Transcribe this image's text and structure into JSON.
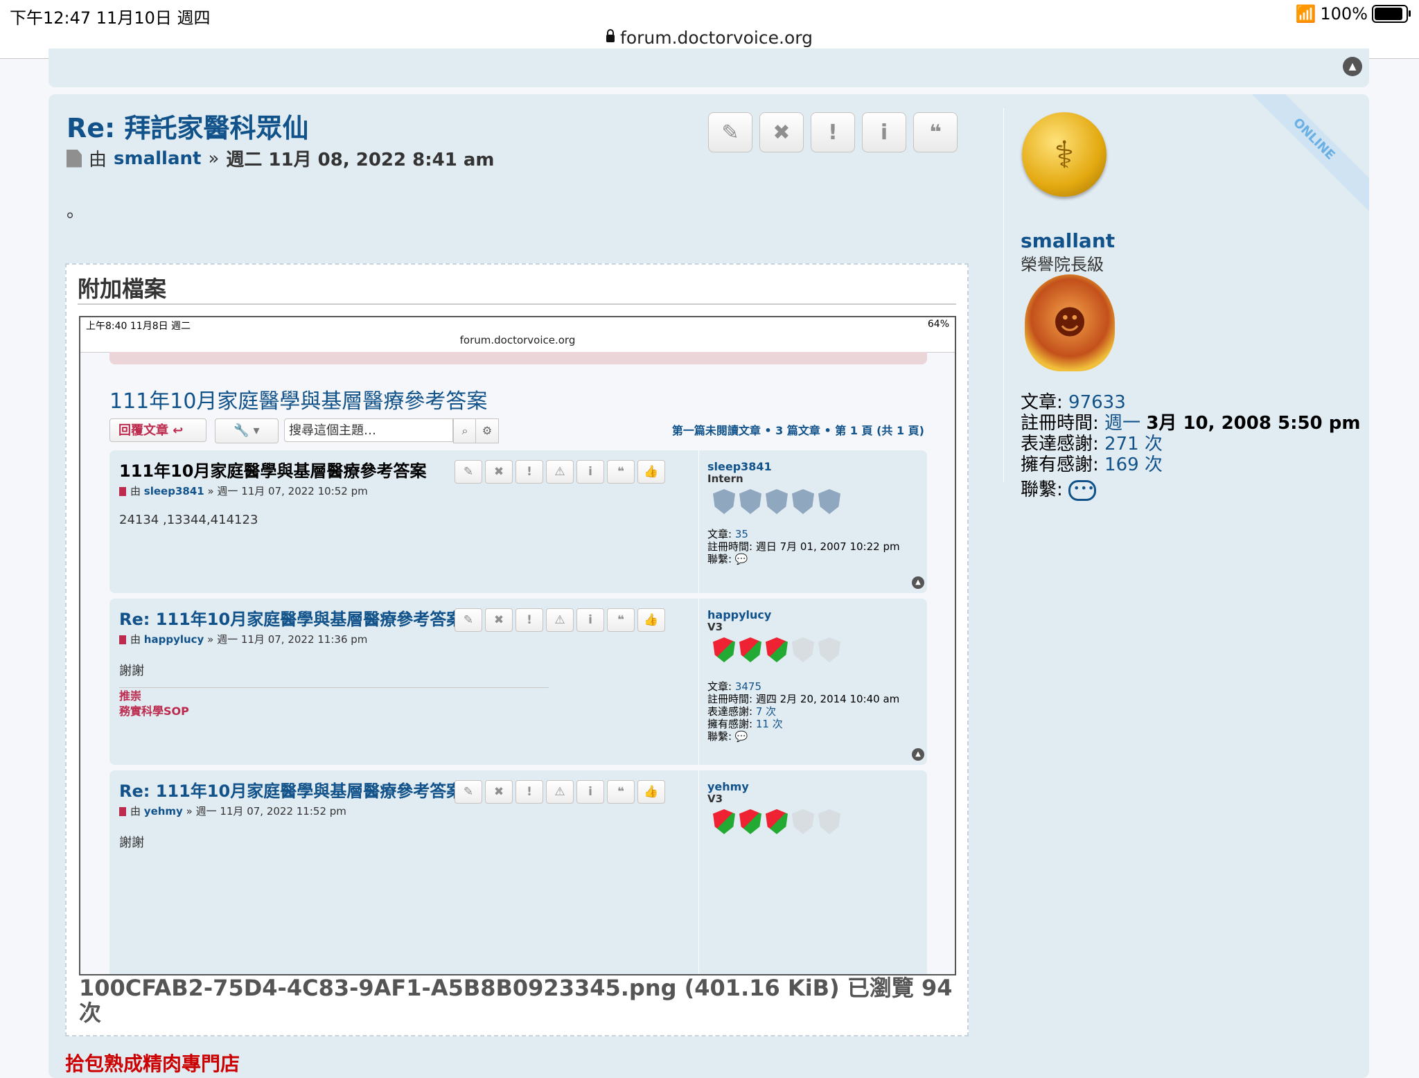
{
  "status_bar": {
    "time": "下午12:47  11月10日 週四",
    "battery": "100%",
    "url": "forum.doctorvoice.org"
  },
  "post": {
    "title": "Re: 拜託家醫科眾仙",
    "by": "由",
    "author": "smallant",
    "sep": "»",
    "date": "週二 11月 08, 2022 8:41 am",
    "body": "。",
    "actions": [
      {
        "name": "edit",
        "glyph": "✎"
      },
      {
        "name": "delete",
        "glyph": "✖"
      },
      {
        "name": "report",
        "glyph": "!"
      },
      {
        "name": "info",
        "glyph": "i"
      },
      {
        "name": "quote",
        "glyph": "❝"
      }
    ],
    "online_badge": "ONLINE"
  },
  "profile": {
    "username": "smallant",
    "rank": "榮譽院長級",
    "posts_label": "文章:",
    "posts": "97633",
    "joined_label": "註冊時間:",
    "joined_day": "週一",
    "joined_date": "3月 10, 2008 5:50 pm",
    "thanks_given_label": "表達感謝:",
    "thanks_given": "271 次",
    "thanks_received_label": "擁有感謝:",
    "thanks_received": "169 次",
    "contact_label": "聯繫:"
  },
  "attachment": {
    "heading": "附加檔案",
    "caption": "100CFAB2-75D4-4C83-9AF1-A5B8B0923345.png (401.16 KiB) 已瀏覽 94 次"
  },
  "inner": {
    "time": "上午8:40  11月8日 週二",
    "battery": "64%",
    "url": "forum.doctorvoice.org",
    "topic_title": "111年10月家庭醫學與基層醫療參考答案",
    "reply_label": "回覆文章 ↩",
    "search_placeholder": "搜尋這個主題…",
    "pagination": "第一篇未閱讀文章 • 3 篇文章 • 第 1 頁 (共 1 頁)",
    "posts": [
      {
        "title": "111年10月家庭醫學與基層醫療參考答案",
        "by": "由",
        "author": "sleep3841",
        "date": "» 週一 11月 07, 2022 10:52 pm",
        "body": "24134 ,13344,414123",
        "user": "sleep3841",
        "rank": "Intern",
        "posts_label": "文章:",
        "posts": "35",
        "joined": "註冊時間: 週日 7月 01, 2007 10:22 pm",
        "contact": "聯繫:"
      },
      {
        "title": "Re: 111年10月家庭醫學與基層醫療參考答案",
        "by": "由",
        "author": "happylucy",
        "date": "» 週一 11月 07, 2022 11:36 pm",
        "body": "謝謝",
        "sig1": "推崇",
        "sig2": "務實科學SOP",
        "user": "happylucy",
        "rank": "V3",
        "posts_label": "文章:",
        "posts": "3475",
        "joined": "註冊時間: 週四 2月 20, 2014 10:40 am",
        "thanks_given_label": "表達感謝:",
        "thanks_given": "7 次",
        "thanks_received_label": "擁有感謝:",
        "thanks_received": "11 次",
        "contact": "聯繫:"
      },
      {
        "title": "Re: 111年10月家庭醫學與基層醫療參考答案",
        "by": "由",
        "author": "yehmy",
        "date": "» 週一 11月 07, 2022 11:52 pm",
        "body": "謝謝",
        "user": "yehmy",
        "rank": "V3"
      }
    ]
  },
  "next_post_title": "拾包熟成精肉專門店",
  "colors": {
    "panel": "#e1ebf2",
    "link": "#105289",
    "reply_red": "#bc2a4d"
  }
}
